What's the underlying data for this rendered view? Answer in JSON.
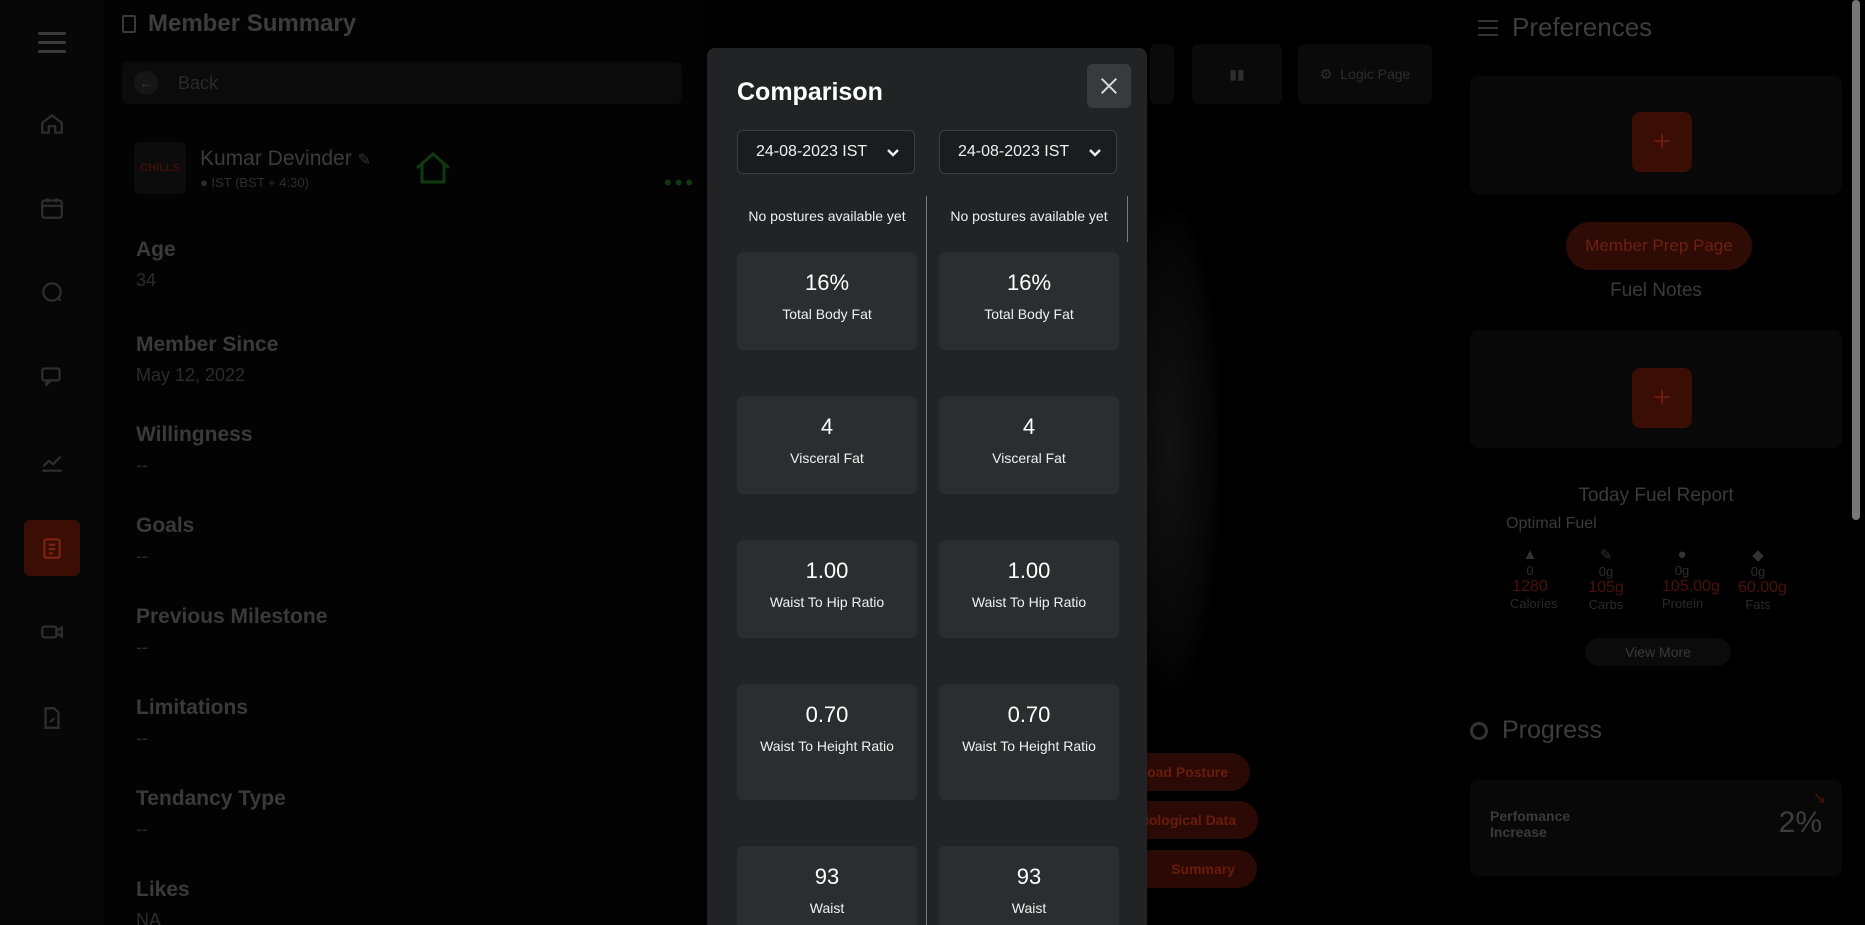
{
  "summary": {
    "title": "Member Summary",
    "back_label": "Back",
    "logo_text": "CHILLS",
    "name": "Kumar Devinder",
    "timezone": "IST (BST + 4:30)",
    "fields": [
      {
        "label": "Age",
        "value": "34"
      },
      {
        "label": "Member Since",
        "value": "May 12, 2022"
      },
      {
        "label": "Willingness",
        "value": "--"
      },
      {
        "label": "Goals",
        "value": "--"
      },
      {
        "label": "Previous Milestone",
        "value": "--"
      },
      {
        "label": "Limitations",
        "value": "--"
      },
      {
        "label": "Tendancy Type",
        "value": "--"
      },
      {
        "label": "Likes",
        "value": "NA"
      }
    ]
  },
  "middle": {
    "logic_page_label": "Logic Page",
    "pills": [
      "Load Posture",
      "Physiological Data",
      "Summary"
    ]
  },
  "preferences": {
    "title": "Preferences",
    "member_prep_label": "Member Prep Page",
    "fuel_notes_label": "Fuel Notes",
    "fuel_report_title": "Today Fuel Report",
    "optimal_fuel_label": "Optimal Fuel",
    "fuel": [
      {
        "icon": "flame-icon",
        "eaten": "0",
        "target": "1280",
        "name": "Calories"
      },
      {
        "icon": "pen-icon",
        "eaten": "0g",
        "target": "105g",
        "name": "Carbs"
      },
      {
        "icon": "drumstick-icon",
        "eaten": "0g",
        "target": "105.00g",
        "name": "Protein"
      },
      {
        "icon": "avocado-icon",
        "eaten": "0g",
        "target": "60.00g",
        "name": "Fats"
      }
    ],
    "view_more_label": "View More",
    "progress_title": "Progress",
    "performance_label": "Perfomance Increase",
    "performance_value": "2%"
  },
  "modal": {
    "title": "Comparison",
    "left_date": "24-08-2023 IST",
    "right_date": "24-08-2023 IST",
    "no_postures": "No postures available yet",
    "metrics": [
      {
        "value": "16%",
        "label": "Total Body Fat"
      },
      {
        "value": "4",
        "label": "Visceral Fat"
      },
      {
        "value": "1.00",
        "label": "Waist To Hip Ratio"
      },
      {
        "value": "0.70",
        "label": "Waist To Height Ratio"
      },
      {
        "value": "93",
        "label": "Waist"
      }
    ]
  },
  "colors": {
    "modal_bg": "#222325",
    "card_bg": "#2c2d30",
    "accent": "#e8401c"
  }
}
